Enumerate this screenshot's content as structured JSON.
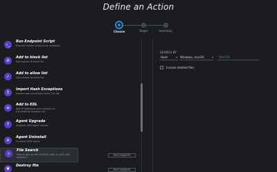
{
  "page": {
    "title": "Define an Action"
  },
  "steps": [
    {
      "label": "Choose",
      "active": true
    },
    {
      "label": "Target",
      "active": false
    },
    {
      "label": "Summary",
      "active": false
    }
  ],
  "actions": [
    {
      "icon": "terminal-icon",
      "glyph": "›_",
      "name": "Run Endpoint Script",
      "desc": "Execute Python script on an endpoint"
    },
    {
      "icon": "block-list-icon",
      "glyph": "⊘",
      "name": "Add to block list",
      "desc": "Add hashes to block list"
    },
    {
      "icon": "allow-list-icon",
      "glyph": "✓",
      "name": "Add to allow list",
      "desc": "Add hashes to allow list"
    },
    {
      "icon": "hash-exception-icon",
      "glyph": "↥",
      "name": "Import Hash Exceptions",
      "desc": "Import hash exceptions from CSV file"
    },
    {
      "icon": "edl-icon",
      "glyph": "≡",
      "name": "Add to EDL",
      "desc": "Add IP addresses and domains to the external dynamic list"
    },
    {
      "icon": "agent-upgrade-icon",
      "glyph": "↑",
      "name": "Agent Upgrade",
      "desc": "Upgrade XDR agent version"
    },
    {
      "icon": "agent-uninstall-icon",
      "glyph": "✕",
      "name": "Agent Uninstall",
      "desc": "Uninstall XDR agent"
    },
    {
      "icon": "file-search-icon",
      "glyph": "⌕",
      "name": "File Search",
      "desc": "Search files by file SHA256, path or path with endpoint",
      "selected": true
    },
    {
      "icon": "destroy-file-icon",
      "glyph": "✖",
      "name": "Destroy file",
      "desc": ""
    }
  ],
  "insights_label": "HOST INSIGHTS",
  "search": {
    "label": "SEARCH BY",
    "type_value": "Hash",
    "os_value": "Windows, macOS",
    "input_placeholder": "SHA256"
  },
  "checkbox": {
    "label": "Include deleted files",
    "checked": false
  }
}
